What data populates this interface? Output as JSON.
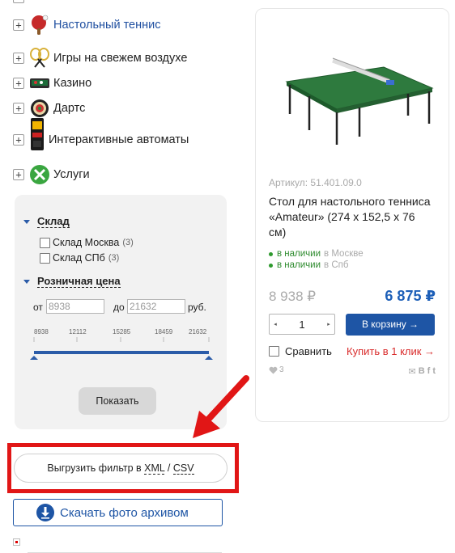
{
  "categories": [
    {
      "label": "Настольный теннис",
      "icon": "ping-pong-paddle-icon",
      "active": true
    },
    {
      "label": "Игры на свежем воздухе",
      "icon": "badminton-rackets-icon",
      "active": false
    },
    {
      "label": "Казино",
      "icon": "casino-table-icon",
      "active": false
    },
    {
      "label": "Дартс",
      "icon": "dartboard-icon",
      "active": false
    },
    {
      "label": "Интерактивные автоматы",
      "icon": "arcade-machine-icon",
      "active": false
    },
    {
      "label": "Услуги",
      "icon": "tools-icon",
      "active": false
    }
  ],
  "expand_symbol": "+",
  "filter": {
    "warehouse": {
      "title": "Склад",
      "options": [
        {
          "label": "Склад Москва",
          "count": "(3)",
          "checked": false
        },
        {
          "label": "Склад СПб",
          "count": "(3)",
          "checked": false
        }
      ]
    },
    "price": {
      "title": "Розничная цена",
      "from_label": "от",
      "to_label": "до",
      "from_placeholder": "8938",
      "to_placeholder": "21632",
      "currency": "руб.",
      "ticks": [
        "8938",
        "12112",
        "15285",
        "18459",
        "21632"
      ],
      "min": 8938,
      "max": 21632
    },
    "show_button": "Показать"
  },
  "export": {
    "label_prefix": "Выгрузить фильтр в",
    "xml": "XML",
    "separator": "/",
    "csv": "CSV"
  },
  "download_button": "Скачать фото архивом",
  "product": {
    "sku": "Артикул: 51.401.09.0",
    "title": "Стол для настольного тенниса «Amateur» (274 x 152,5 x 76 см)",
    "availability": [
      {
        "status": "в наличии",
        "location": "в Москве"
      },
      {
        "status": "в наличии",
        "location": "в Спб"
      }
    ],
    "old_price": "8 938 ₽",
    "price": "6 875 ₽",
    "quantity": "1",
    "qty_down": "◂",
    "qty_up": "▸",
    "cart_button": "В корзину →",
    "compare_label": "Сравнить",
    "one_click": "Купить в 1 клик →",
    "likes": "3",
    "share_icons": [
      "email-icon",
      "vk-icon",
      "facebook-icon",
      "twitter-icon"
    ],
    "share_glyphs": [
      "✉",
      "В",
      "f",
      "t"
    ]
  },
  "colors": {
    "accent": "#1e55a5",
    "link": "#1f4fa0",
    "in_stock": "#2e8b2e",
    "highlight": "#e11616",
    "one_click": "#d92b2b"
  }
}
